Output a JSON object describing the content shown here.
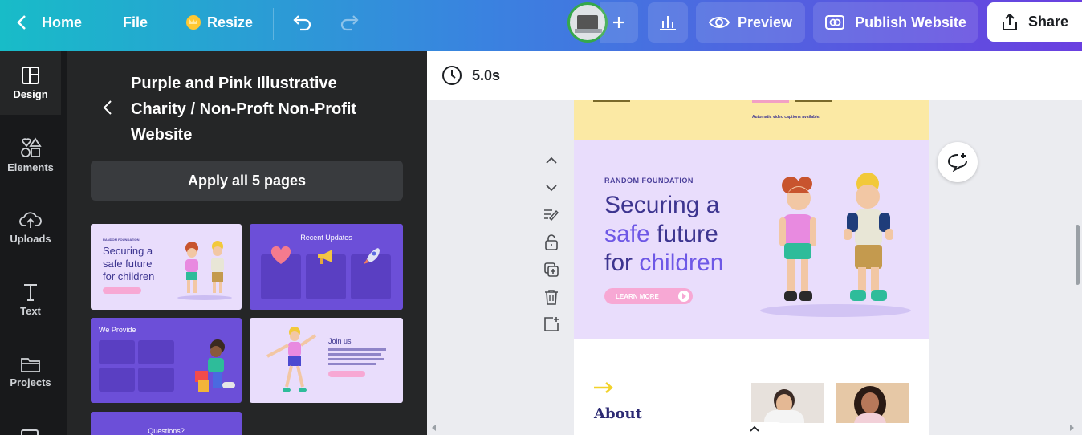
{
  "topbar": {
    "home_label": "Home",
    "file_label": "File",
    "resize_label": "Resize",
    "preview_label": "Preview",
    "publish_label": "Publish Website",
    "share_label": "Share"
  },
  "rail": {
    "items": [
      {
        "label": "Design"
      },
      {
        "label": "Elements"
      },
      {
        "label": "Uploads"
      },
      {
        "label": "Text"
      },
      {
        "label": "Projects"
      }
    ]
  },
  "panel": {
    "title": "Purple and Pink Illustrative Charity / Non-Proft Non-Profit Website",
    "apply_label": "Apply all 5 pages",
    "thumbs": {
      "t1_eyebrow": "RANDOM FOUNDATION",
      "t1_title_line1": "Securing a",
      "t1_title_line2": "safe future",
      "t1_title_line3": "for children",
      "t2_title": "Recent Updates",
      "t3_title": "We Provide",
      "t4_title": "Join us",
      "t5_title": "Questions?"
    }
  },
  "canvas": {
    "duration": "5.0s",
    "top_strip_text": "Automatic video captions available.",
    "hero": {
      "eyebrow": "RANDOM FOUNDATION",
      "line1": "Securing a",
      "line2_highlight": "safe",
      "line2_rest": " future",
      "line3_prefix": "for ",
      "line3_highlight": "children",
      "button_label": "LEARN MORE"
    },
    "about_label": "About"
  },
  "colors": {
    "topbar_start": "#18bcc8",
    "topbar_end": "#6a3fe0",
    "panel_bg": "#252627",
    "hero_bg": "#e9ddfc",
    "accent_purple": "#6e58e6",
    "accent_pink": "#f7a8d4"
  }
}
